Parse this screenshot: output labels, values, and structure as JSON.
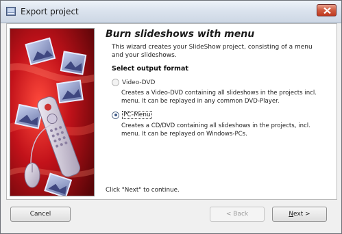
{
  "window": {
    "title": "Export project"
  },
  "wizard": {
    "heading": "Burn slideshows with menu",
    "intro": "This wizard creates your SlideShow project, consisting of a menu and your slideshows.",
    "section_title": "Select output format",
    "options": [
      {
        "label": "Video-DVD",
        "selected": false,
        "description": "Creates a Video-DVD containing all slideshows in the projects incl. menu. It can be replayed in any common DVD-Player."
      },
      {
        "label": "PC-Menu",
        "selected": true,
        "description": "Creates a CD/DVD containing all slideshows in the projects, incl. menu. It can be replayed on Windows-PCs."
      }
    ],
    "continue_hint": "Click \"Next\" to continue."
  },
  "buttons": {
    "cancel": "Cancel",
    "back": "< Back",
    "next_rest": "ext >",
    "next_key": "N"
  },
  "colors": {
    "banner_red": "#c0141a",
    "accent_blue": "#3d5a8a"
  }
}
